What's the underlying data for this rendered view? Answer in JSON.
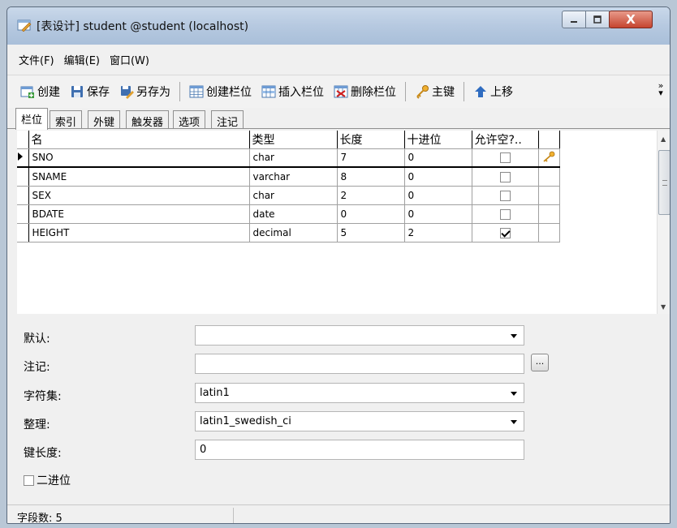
{
  "window": {
    "title": "[表设计] student @student (localhost)",
    "close_glyph": "X"
  },
  "menu": {
    "items": [
      "文件(F)",
      "编辑(E)",
      "窗口(W)"
    ]
  },
  "toolbar": {
    "create": "创建",
    "save": "保存",
    "save_as": "另存为",
    "add_field": "创建栏位",
    "insert_field": "插入栏位",
    "delete_field": "删除栏位",
    "primary_key": "主键",
    "move_up": "上移",
    "more": "»"
  },
  "tabs": [
    "栏位",
    "索引",
    "外键",
    "触发器",
    "选项",
    "注记"
  ],
  "grid": {
    "columns": [
      "名",
      "类型",
      "长度",
      "十进位",
      "允许空?.."
    ],
    "rows": [
      {
        "name": "SNO",
        "type": "char",
        "length": "7",
        "decimals": "0",
        "allow_null": false,
        "primary_key": true
      },
      {
        "name": "SNAME",
        "type": "varchar",
        "length": "8",
        "decimals": "0",
        "allow_null": false,
        "primary_key": false
      },
      {
        "name": "SEX",
        "type": "char",
        "length": "2",
        "decimals": "0",
        "allow_null": false,
        "primary_key": false
      },
      {
        "name": "BDATE",
        "type": "date",
        "length": "0",
        "decimals": "0",
        "allow_null": false,
        "primary_key": false
      },
      {
        "name": "HEIGHT",
        "type": "decimal",
        "length": "5",
        "decimals": "2",
        "allow_null": true,
        "primary_key": false
      }
    ]
  },
  "form": {
    "default_label": "默认:",
    "default_value": "",
    "comment_label": "注记:",
    "comment_value": "",
    "comment_button": "...",
    "charset_label": "字符集:",
    "charset_value": "latin1",
    "collation_label": "整理:",
    "collation_value": "latin1_swedish_ci",
    "key_length_label": "键长度:",
    "key_length_value": "0",
    "binary_label": "二进位",
    "binary_checked": false
  },
  "status": {
    "field_count": "字段数: 5"
  },
  "colors": {
    "key_icon": "#e8a317",
    "close_button": "#c5442f"
  }
}
